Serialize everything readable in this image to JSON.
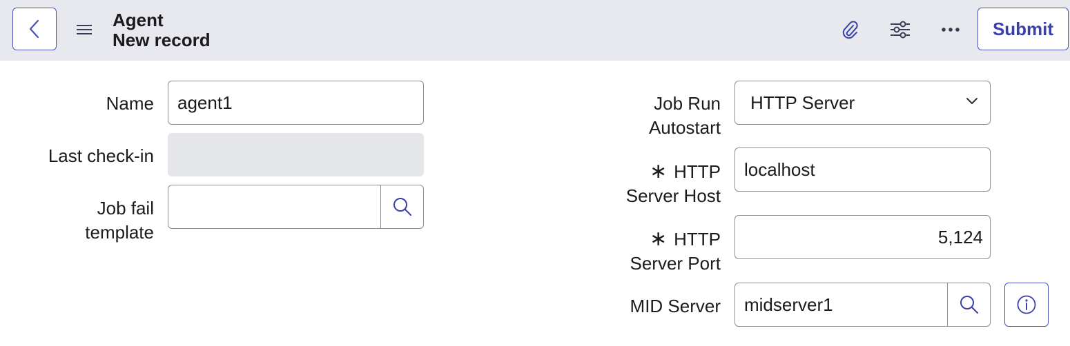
{
  "header": {
    "back_icon": "chevron-left-icon",
    "menu_icon": "hamburger-icon",
    "title": "Agent",
    "subtitle": "New record",
    "attach_icon": "paperclip-icon",
    "settings_icon": "sliders-icon",
    "more_icon": "more-dots-icon",
    "submit_label": "Submit"
  },
  "form": {
    "name": {
      "label": "Name",
      "value": "agent1"
    },
    "last_checkin": {
      "label": "Last check-in",
      "value": ""
    },
    "job_fail_template": {
      "label_line1": "Job fail",
      "label_line2": "template",
      "value": ""
    },
    "job_run_autostart": {
      "label_line1": "Job Run",
      "label_line2": "Autostart",
      "value": "HTTP Server"
    },
    "http_server_host": {
      "required_mark": "∗",
      "label_line1": "HTTP",
      "label_line2": "Server Host",
      "value": "localhost"
    },
    "http_server_port": {
      "required_mark": "∗",
      "label_line1": "HTTP",
      "label_line2": "Server Port",
      "value": "5,124"
    },
    "mid_server": {
      "label": "MID Server",
      "value": "midserver1"
    }
  },
  "colors": {
    "accent": "#4b4fb8",
    "header_bg": "#e8e9ee",
    "readonly_bg": "#e5e6ea",
    "border": "#8c8c94"
  }
}
